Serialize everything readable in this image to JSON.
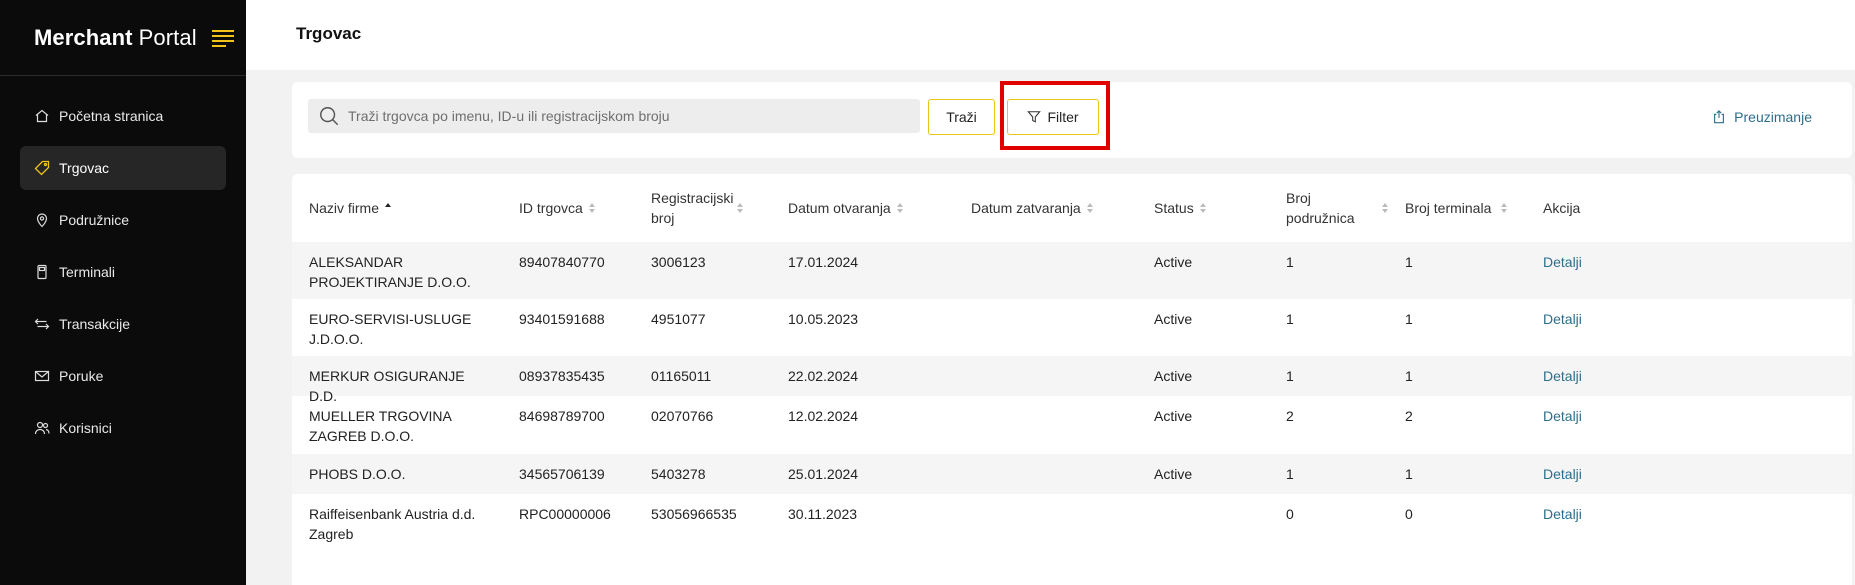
{
  "sidebar": {
    "brand_bold": "Merchant",
    "brand_light": "Portal",
    "items": [
      {
        "label": "Početna stranica",
        "icon": "home-icon"
      },
      {
        "label": "Trgovac",
        "icon": "tag-icon"
      },
      {
        "label": "Podružnice",
        "icon": "location-pin-icon"
      },
      {
        "label": "Terminali",
        "icon": "pos-terminal-icon"
      },
      {
        "label": "Transakcije",
        "icon": "transfer-arrows-icon"
      },
      {
        "label": "Poruke",
        "icon": "mail-icon"
      },
      {
        "label": "Korisnici",
        "icon": "users-icon"
      }
    ],
    "active_index": 1,
    "accent_color": "#f0c419"
  },
  "header": {
    "title": "Trgovac"
  },
  "search": {
    "placeholder": "Traži trgovca po imenu, ID-u ili registracijskom broju",
    "search_label": "Traži",
    "filter_label": "Filter",
    "download_label": "Preuzimanje"
  },
  "table": {
    "columns": [
      {
        "label": "Naziv firme"
      },
      {
        "label": "ID trgovca"
      },
      {
        "label": "Registracijski broj"
      },
      {
        "label": "Datum otvaranja"
      },
      {
        "label": "Datum zatvaranja"
      },
      {
        "label": "Status"
      },
      {
        "label": "Broj podružnica"
      },
      {
        "label": "Broj terminala"
      },
      {
        "label": "Akcija"
      }
    ],
    "rows": [
      {
        "name": "ALEKSANDAR PROJEKTIRANJE D.O.O.",
        "id": "89407840770",
        "reg": "3006123",
        "opened": "17.01.2024",
        "closed": "",
        "status": "Active",
        "branches": "1",
        "terminals": "1",
        "action": "Detalji"
      },
      {
        "name": "EURO-SERVISI-USLUGE J.D.O.O.",
        "id": "93401591688",
        "reg": "4951077",
        "opened": "10.05.2023",
        "closed": "",
        "status": "Active",
        "branches": "1",
        "terminals": "1",
        "action": "Detalji"
      },
      {
        "name": "MERKUR OSIGURANJE D.D.",
        "id": "08937835435",
        "reg": "01165011",
        "opened": "22.02.2024",
        "closed": "",
        "status": "Active",
        "branches": "1",
        "terminals": "1",
        "action": "Detalji"
      },
      {
        "name": "MUELLER TRGOVINA ZAGREB D.O.O.",
        "id": "84698789700",
        "reg": "02070766",
        "opened": "12.02.2024",
        "closed": "",
        "status": "Active",
        "branches": "2",
        "terminals": "2",
        "action": "Detalji"
      },
      {
        "name": "PHOBS D.O.O.",
        "id": "34565706139",
        "reg": "5403278",
        "opened": "25.01.2024",
        "closed": "",
        "status": "Active",
        "branches": "1",
        "terminals": "1",
        "action": "Detalji"
      },
      {
        "name": "Raiffeisenbank Austria d.d. Zagreb",
        "id": "RPC00000006",
        "reg": "53056966535",
        "opened": "30.11.2023",
        "closed": "",
        "status": "",
        "branches": "0",
        "terminals": "0",
        "action": "Detalji"
      }
    ]
  }
}
